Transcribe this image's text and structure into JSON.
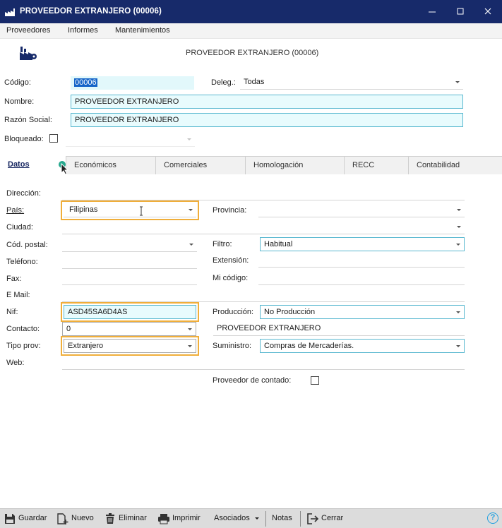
{
  "window": {
    "title": "PROVEEDOR EXTRANJERO (00006)",
    "icon": "factory-icon"
  },
  "menu": [
    "Proveedores",
    "Informes",
    "Mantenimientos"
  ],
  "header": {
    "title": "PROVEEDOR EXTRANJERO (00006)"
  },
  "form": {
    "codigo_label": "Código:",
    "codigo_value": "00006",
    "deleg_label": "Deleg.:",
    "deleg_value": "Todas",
    "nombre_label": "Nombre:",
    "nombre_value": "PROVEEDOR EXTRANJERO",
    "razon_label": "Razón Social:",
    "razon_value": "PROVEEDOR EXTRANJERO",
    "bloqueado_label": "Bloqueado:",
    "bloqueado_checked": false
  },
  "tabs": [
    "Datos",
    "Económicos",
    "Comerciales",
    "Homologación",
    "RECC",
    "Contabilidad"
  ],
  "datos": {
    "direccion_label": "Dirección:",
    "direccion_value": "",
    "pais_label": "País:",
    "pais_value": "Filipinas",
    "provincia_label": "Provincia:",
    "provincia_value": "",
    "ciudad_label": "Ciudad:",
    "ciudad_value": "",
    "cp_label": "Cód. postal:",
    "cp_value": "",
    "filtro_label": "Filtro:",
    "filtro_value": "Habitual",
    "telefono_label": "Teléfono:",
    "telefono_value": "",
    "extension_label": "Extensión:",
    "extension_value": "",
    "fax_label": "Fax:",
    "fax_value": "",
    "micodigo_label": "Mi código:",
    "micodigo_value": "",
    "email_label": "E Mail:",
    "email_value": "",
    "nif_label": "Nif:",
    "nif_value": "ASD45SA6D4AS",
    "produccion_label": "Producción:",
    "produccion_value": "No Producción",
    "contacto_label": "Contacto:",
    "contacto_value": "0",
    "contacto_name": "PROVEEDOR EXTRANJERO",
    "tipoprov_label": "Tipo prov:",
    "tipoprov_value": "Extranjero",
    "suministro_label": "Suministro:",
    "suministro_value": "Compras de Mercaderías.",
    "web_label": "Web:",
    "web_value": "",
    "contado_label": "Proveedor de contado:",
    "contado_checked": false
  },
  "toolbar": {
    "guardar": "Guardar",
    "nuevo": "Nuevo",
    "eliminar": "Eliminar",
    "imprimir": "Imprimir",
    "asociados": "Asociados",
    "notas": "Notas",
    "cerrar": "Cerrar",
    "help_icon": "help-icon"
  },
  "colors": {
    "titlebar": "#172a6a",
    "field_border": "#5ab8d0",
    "field_bg": "#e8fbfd",
    "highlight": "#f0ae3a",
    "selection": "#1464c8",
    "help": "#1fa0e0"
  }
}
